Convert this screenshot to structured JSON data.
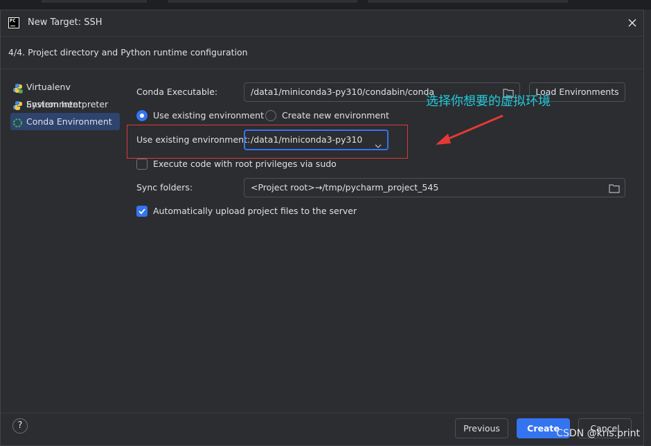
{
  "window": {
    "title": "New Target: SSH"
  },
  "step": {
    "title": "4/4. Project directory and Python runtime configuration"
  },
  "sidebar": {
    "items": [
      {
        "label": "Virtualenv Environment",
        "icon": "virtualenv-icon",
        "selected": false
      },
      {
        "label": "System Interpreter",
        "icon": "python-icon",
        "selected": false
      },
      {
        "label": "Conda Environment",
        "icon": "conda-icon",
        "selected": true
      }
    ]
  },
  "form": {
    "conda_executable_label": "Conda Executable:",
    "conda_executable_value": "/data1/miniconda3-py310/condabin/conda",
    "load_environments_label": "Load Environments",
    "radio_existing_label": "Use existing environment",
    "radio_new_label": "Create new environment",
    "existing_env_label": "Use existing environment:",
    "existing_env_value": "/data1/miniconda3-py310",
    "sudo_label": "Execute code with root privileges via sudo",
    "sudo_checked": false,
    "sync_folders_label": "Sync folders:",
    "sync_folders_value": "<Project root>→/tmp/pycharm_project_545",
    "auto_upload_label": "Automatically upload project files to the server",
    "auto_upload_checked": true
  },
  "annotation": {
    "text": "选择你想要的虚拟环境",
    "color": "#21c9d9"
  },
  "footer": {
    "help_label": "?",
    "previous_label": "Previous",
    "create_label": "Create",
    "cancel_label": "Cancel"
  },
  "watermark": "CSDN @kris.print",
  "colors": {
    "accent": "#3574f0",
    "background": "#2b2d30",
    "highlight": "#e0393e"
  }
}
